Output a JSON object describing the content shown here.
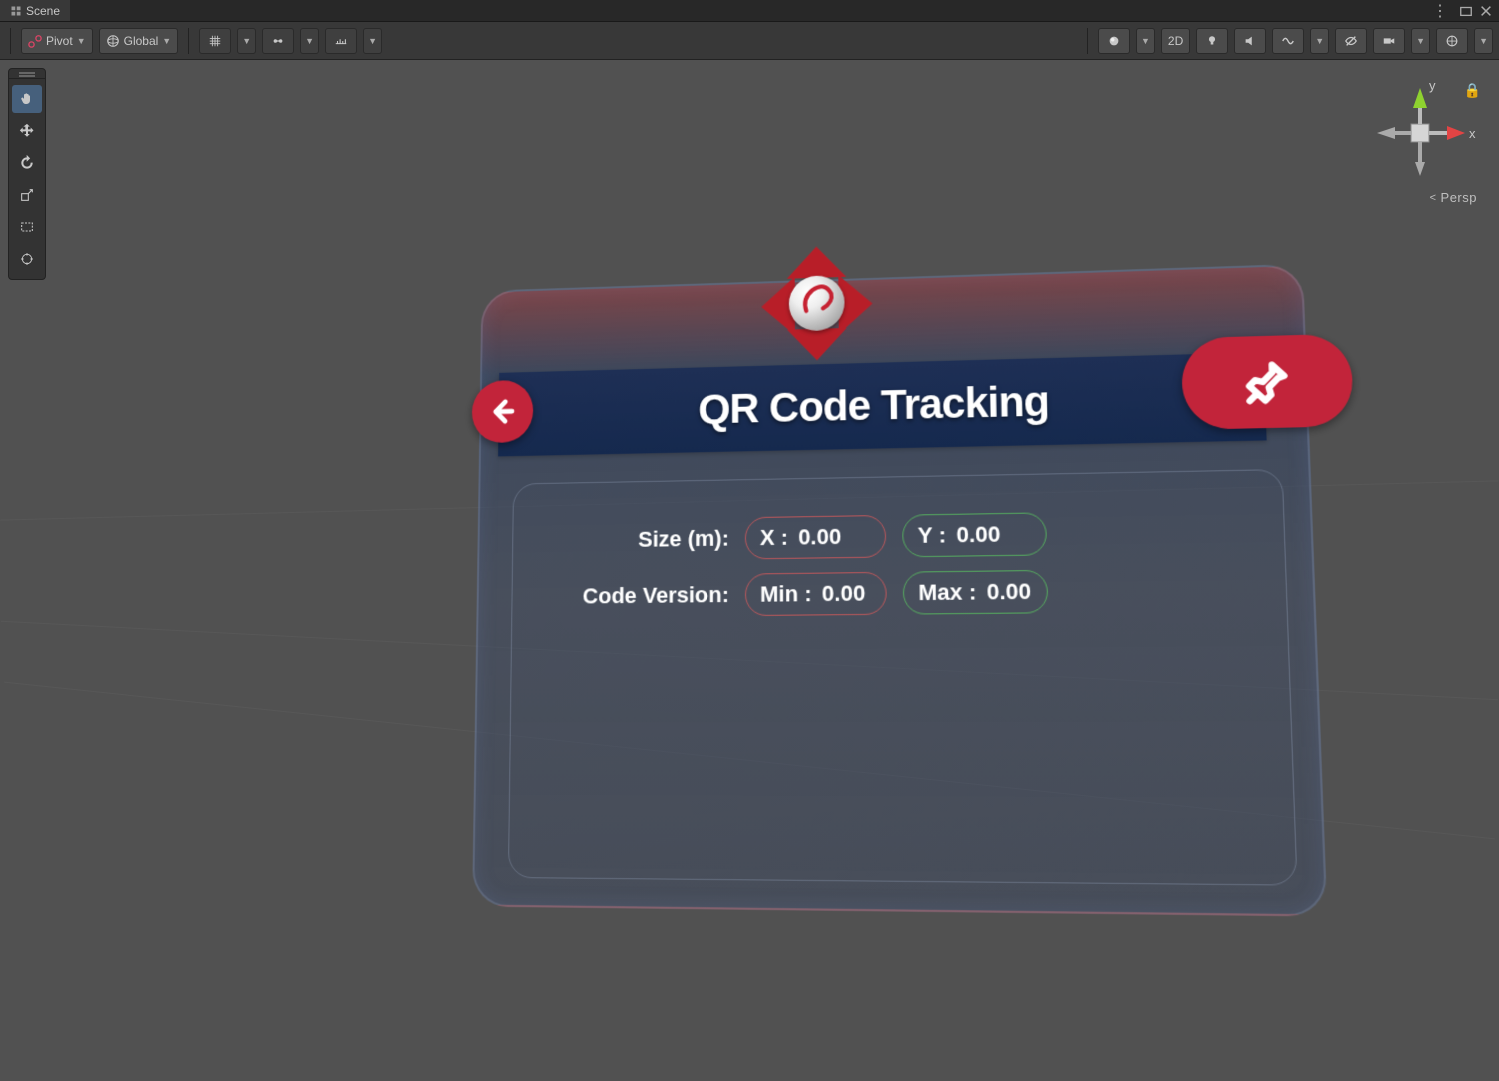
{
  "tabs": {
    "scene": "Scene"
  },
  "topbar": {
    "pivot_label": "Pivot",
    "space_label": "Global",
    "mode_2d": "2D"
  },
  "gizmo": {
    "x_label": "x",
    "y_label": "y",
    "projection": "Persp"
  },
  "panel": {
    "title": "QR Code Tracking",
    "size_label": "Size (m):",
    "version_label": "Code Version:",
    "x_label": "X :",
    "x_value": "0.00",
    "y_label": "Y :",
    "y_value": "0.00",
    "min_label": "Min :",
    "min_value": "0.00",
    "max_label": "Max :",
    "max_value": "0.00"
  }
}
